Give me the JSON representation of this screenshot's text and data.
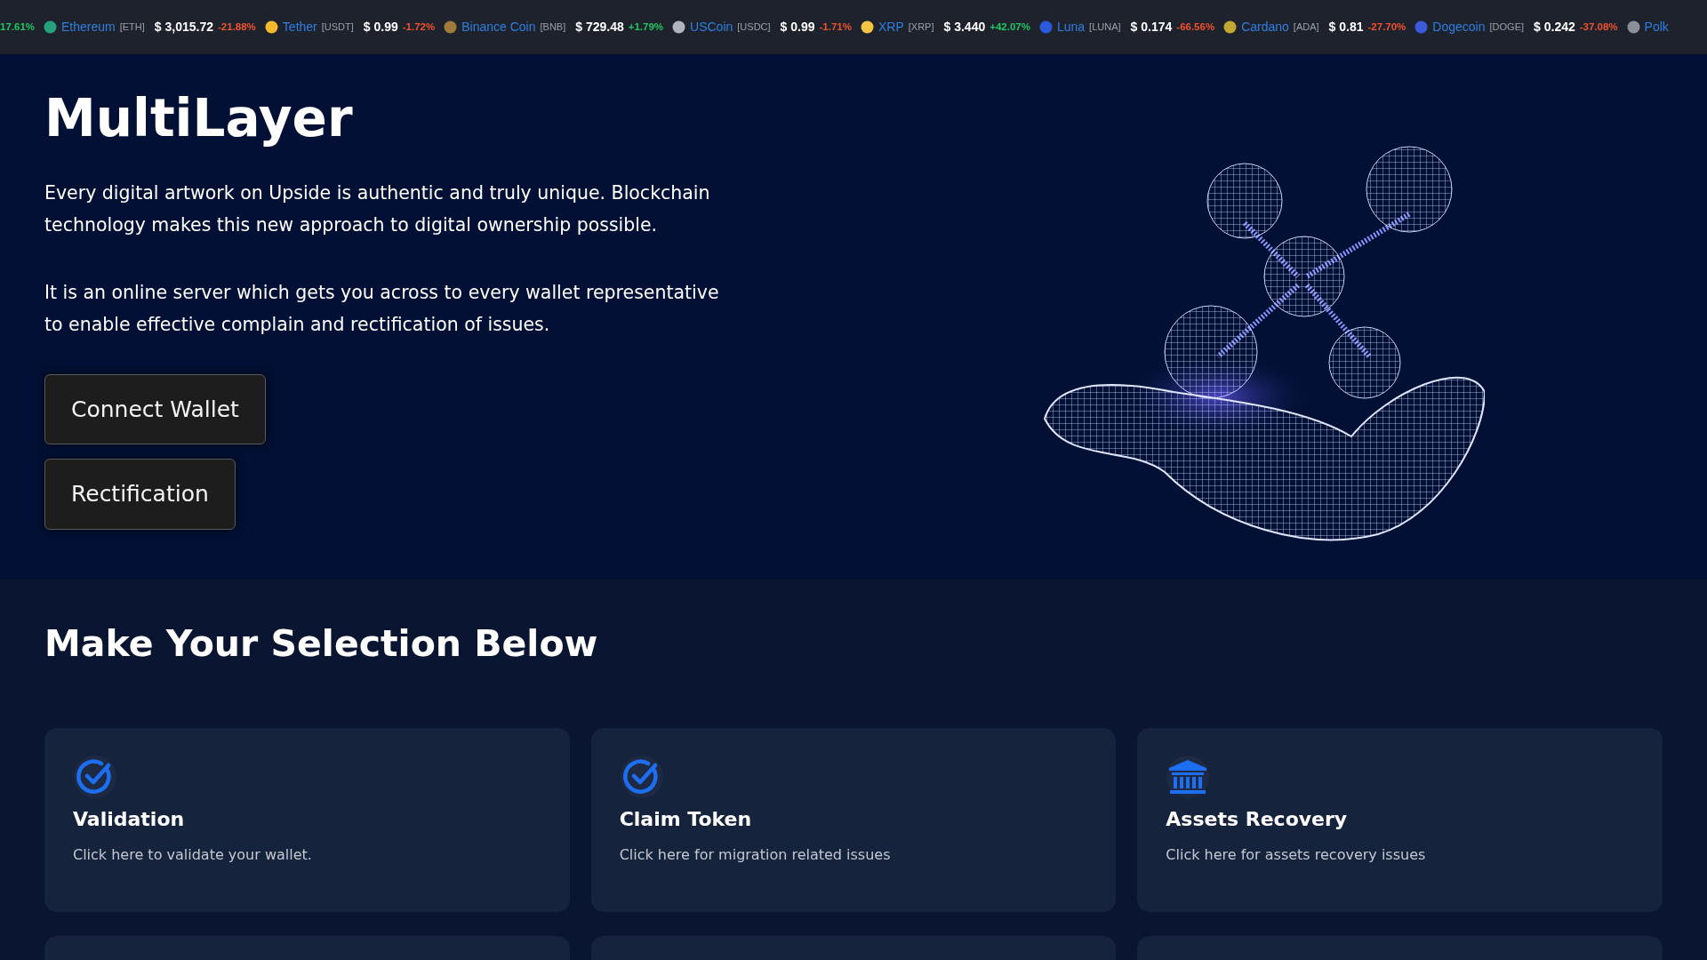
{
  "ticker": [
    {
      "kind": "change-only",
      "change": "17.61%",
      "color": "#22c55e"
    },
    {
      "kind": "full",
      "name": "Ethereum",
      "symbol": "[ETH]",
      "price": "$ 3,015.72",
      "change": "-21.88%",
      "color": "#f0522e"
    },
    {
      "kind": "full",
      "name": "Tether",
      "symbol": "[USDT]",
      "price": "$ 0.99",
      "change": "-1.72%",
      "color": "#f0522e"
    },
    {
      "kind": "full",
      "name": "Binance Coin",
      "symbol": "[BNB]",
      "price": "$ 729.48",
      "change": "+1.79%",
      "color": "#22c55e"
    },
    {
      "kind": "full",
      "name": "USCoin",
      "symbol": "[USDC]",
      "price": "$ 0.99",
      "change": "-1.71%",
      "color": "#f0522e"
    },
    {
      "kind": "full",
      "name": "XRP",
      "symbol": "[XRP]",
      "price": "$ 3.440",
      "change": "+42.07%",
      "color": "#22c55e"
    },
    {
      "kind": "full",
      "name": "Luna",
      "symbol": "[LUNA]",
      "price": "$ 0.174",
      "change": "-66.56%",
      "color": "#f0522e"
    },
    {
      "kind": "full",
      "name": "Cardano",
      "symbol": "[ADA]",
      "price": "$ 0.81",
      "change": "-27.70%",
      "color": "#f0522e"
    },
    {
      "kind": "full",
      "name": "Dogecoin",
      "symbol": "[DOGE]",
      "price": "$ 0.242",
      "change": "-37.08%",
      "color": "#f0522e"
    },
    {
      "kind": "name-only",
      "name": "Polk"
    }
  ],
  "hero": {
    "title": "MultiLayer",
    "paragraphs": [
      "Every digital artwork on Upside is authentic and truly unique. Blockchain technology makes this new approach to digital ownership possible.",
      "It is an online server which gets you across to every wallet representative to enable effective complain and rectification of issues."
    ],
    "buttons": [
      "Connect Wallet",
      "Rectification"
    ]
  },
  "selection": {
    "heading": "Make Your Selection Below",
    "cards": [
      {
        "kind": "check",
        "title": "Validation",
        "text": "Click here to validate your wallet."
      },
      {
        "kind": "check",
        "title": "Claim Token",
        "text": "Click here for migration related issues"
      },
      {
        "kind": "bank",
        "title": "Assets Recovery",
        "text": "Click here for assets recovery issues"
      },
      {
        "kind": "empty"
      },
      {
        "kind": "empty"
      },
      {
        "kind": "empty"
      }
    ]
  }
}
